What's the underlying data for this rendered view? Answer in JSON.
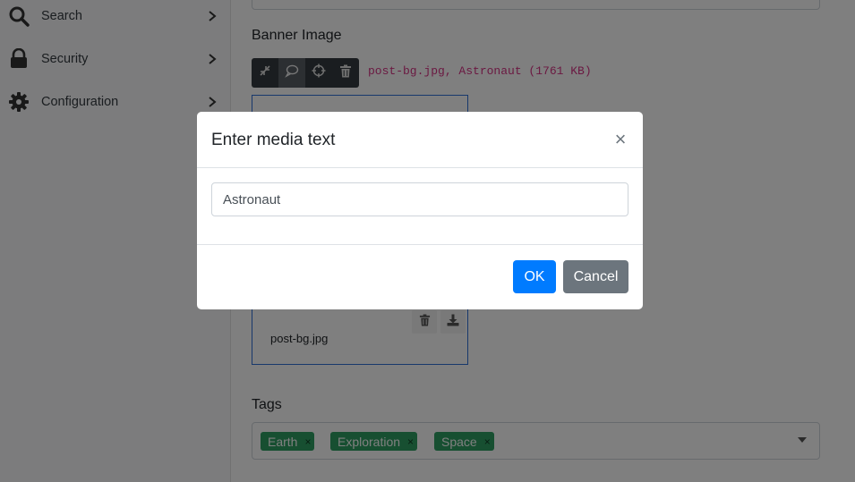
{
  "sidebar": {
    "items": [
      {
        "label": "Search",
        "icon": "search-icon"
      },
      {
        "label": "Security",
        "icon": "lock-icon"
      },
      {
        "label": "Configuration",
        "icon": "gear-icon"
      }
    ]
  },
  "main": {
    "banner_label": "Banner Image",
    "toolbar": [
      "minimize-icon",
      "comment-icon",
      "crosshair-icon",
      "trash-icon"
    ],
    "file_meta": "post-bg.jpg, Astronaut (1761 KB)",
    "media": {
      "filename": "post-bg.jpg",
      "actions": [
        "trash-icon",
        "download-icon"
      ]
    },
    "tags_label": "Tags",
    "tags": [
      {
        "label": "Earth",
        "close": "×"
      },
      {
        "label": "Exploration",
        "close": "×"
      },
      {
        "label": "Space",
        "close": "×"
      }
    ]
  },
  "modal": {
    "title": "Enter media text",
    "close_glyph": "×",
    "input_value": "Astronaut",
    "ok_label": "OK",
    "cancel_label": "Cancel"
  },
  "colors": {
    "primary": "#007bff",
    "secondary": "#6c757d",
    "tag": "#2e9f63",
    "accent_code": "#d63384"
  }
}
